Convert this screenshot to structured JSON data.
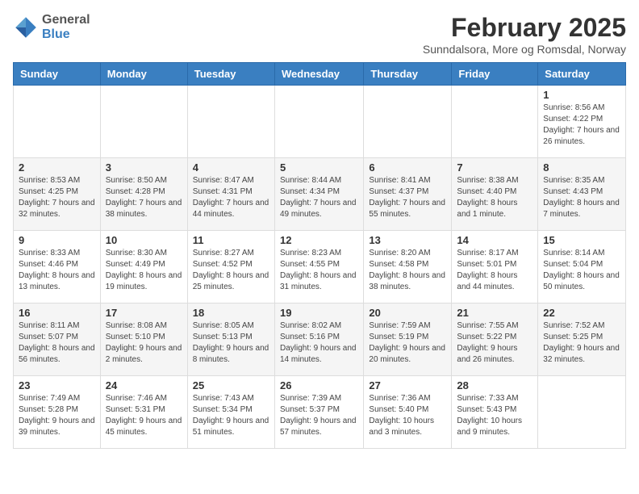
{
  "logo": {
    "line1": "General",
    "line2": "Blue"
  },
  "title": "February 2025",
  "subtitle": "Sunndalsora, More og Romsdal, Norway",
  "weekdays": [
    "Sunday",
    "Monday",
    "Tuesday",
    "Wednesday",
    "Thursday",
    "Friday",
    "Saturday"
  ],
  "weeks": [
    [
      {
        "day": "",
        "info": ""
      },
      {
        "day": "",
        "info": ""
      },
      {
        "day": "",
        "info": ""
      },
      {
        "day": "",
        "info": ""
      },
      {
        "day": "",
        "info": ""
      },
      {
        "day": "",
        "info": ""
      },
      {
        "day": "1",
        "info": "Sunrise: 8:56 AM\nSunset: 4:22 PM\nDaylight: 7 hours and 26 minutes."
      }
    ],
    [
      {
        "day": "2",
        "info": "Sunrise: 8:53 AM\nSunset: 4:25 PM\nDaylight: 7 hours and 32 minutes."
      },
      {
        "day": "3",
        "info": "Sunrise: 8:50 AM\nSunset: 4:28 PM\nDaylight: 7 hours and 38 minutes."
      },
      {
        "day": "4",
        "info": "Sunrise: 8:47 AM\nSunset: 4:31 PM\nDaylight: 7 hours and 44 minutes."
      },
      {
        "day": "5",
        "info": "Sunrise: 8:44 AM\nSunset: 4:34 PM\nDaylight: 7 hours and 49 minutes."
      },
      {
        "day": "6",
        "info": "Sunrise: 8:41 AM\nSunset: 4:37 PM\nDaylight: 7 hours and 55 minutes."
      },
      {
        "day": "7",
        "info": "Sunrise: 8:38 AM\nSunset: 4:40 PM\nDaylight: 8 hours and 1 minute."
      },
      {
        "day": "8",
        "info": "Sunrise: 8:35 AM\nSunset: 4:43 PM\nDaylight: 8 hours and 7 minutes."
      }
    ],
    [
      {
        "day": "9",
        "info": "Sunrise: 8:33 AM\nSunset: 4:46 PM\nDaylight: 8 hours and 13 minutes."
      },
      {
        "day": "10",
        "info": "Sunrise: 8:30 AM\nSunset: 4:49 PM\nDaylight: 8 hours and 19 minutes."
      },
      {
        "day": "11",
        "info": "Sunrise: 8:27 AM\nSunset: 4:52 PM\nDaylight: 8 hours and 25 minutes."
      },
      {
        "day": "12",
        "info": "Sunrise: 8:23 AM\nSunset: 4:55 PM\nDaylight: 8 hours and 31 minutes."
      },
      {
        "day": "13",
        "info": "Sunrise: 8:20 AM\nSunset: 4:58 PM\nDaylight: 8 hours and 38 minutes."
      },
      {
        "day": "14",
        "info": "Sunrise: 8:17 AM\nSunset: 5:01 PM\nDaylight: 8 hours and 44 minutes."
      },
      {
        "day": "15",
        "info": "Sunrise: 8:14 AM\nSunset: 5:04 PM\nDaylight: 8 hours and 50 minutes."
      }
    ],
    [
      {
        "day": "16",
        "info": "Sunrise: 8:11 AM\nSunset: 5:07 PM\nDaylight: 8 hours and 56 minutes."
      },
      {
        "day": "17",
        "info": "Sunrise: 8:08 AM\nSunset: 5:10 PM\nDaylight: 9 hours and 2 minutes."
      },
      {
        "day": "18",
        "info": "Sunrise: 8:05 AM\nSunset: 5:13 PM\nDaylight: 9 hours and 8 minutes."
      },
      {
        "day": "19",
        "info": "Sunrise: 8:02 AM\nSunset: 5:16 PM\nDaylight: 9 hours and 14 minutes."
      },
      {
        "day": "20",
        "info": "Sunrise: 7:59 AM\nSunset: 5:19 PM\nDaylight: 9 hours and 20 minutes."
      },
      {
        "day": "21",
        "info": "Sunrise: 7:55 AM\nSunset: 5:22 PM\nDaylight: 9 hours and 26 minutes."
      },
      {
        "day": "22",
        "info": "Sunrise: 7:52 AM\nSunset: 5:25 PM\nDaylight: 9 hours and 32 minutes."
      }
    ],
    [
      {
        "day": "23",
        "info": "Sunrise: 7:49 AM\nSunset: 5:28 PM\nDaylight: 9 hours and 39 minutes."
      },
      {
        "day": "24",
        "info": "Sunrise: 7:46 AM\nSunset: 5:31 PM\nDaylight: 9 hours and 45 minutes."
      },
      {
        "day": "25",
        "info": "Sunrise: 7:43 AM\nSunset: 5:34 PM\nDaylight: 9 hours and 51 minutes."
      },
      {
        "day": "26",
        "info": "Sunrise: 7:39 AM\nSunset: 5:37 PM\nDaylight: 9 hours and 57 minutes."
      },
      {
        "day": "27",
        "info": "Sunrise: 7:36 AM\nSunset: 5:40 PM\nDaylight: 10 hours and 3 minutes."
      },
      {
        "day": "28",
        "info": "Sunrise: 7:33 AM\nSunset: 5:43 PM\nDaylight: 10 hours and 9 minutes."
      },
      {
        "day": "",
        "info": ""
      }
    ]
  ]
}
